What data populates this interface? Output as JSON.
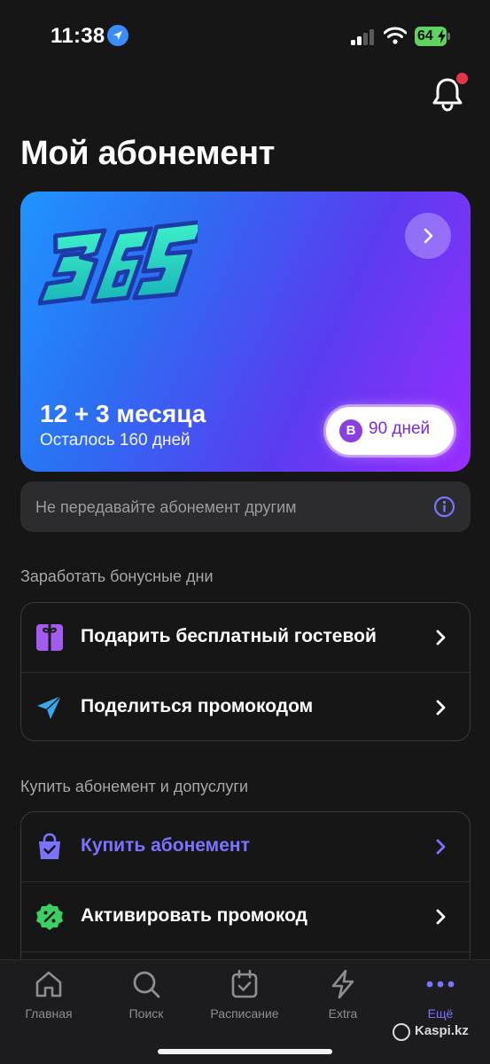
{
  "status_bar": {
    "time": "11:38",
    "battery": "64"
  },
  "page": {
    "title": "Мой абонемент"
  },
  "subscription": {
    "plan": "12 + 3 месяца",
    "remaining": "Осталось 160 дней",
    "badge_letter": "B",
    "badge_text": "90 дней"
  },
  "notice": {
    "text": "Не передавайте абонемент другим"
  },
  "bonus_section": {
    "title": "Заработать бонусные дни",
    "items": [
      {
        "label": "Подарить бесплатный гостевой",
        "icon": "gift-icon"
      },
      {
        "label": "Поделиться промокодом",
        "icon": "send-icon"
      }
    ]
  },
  "buy_section": {
    "title": "Купить абонемент и допуслуги",
    "items": [
      {
        "label": "Купить абонемент",
        "icon": "shopping-bag-icon"
      },
      {
        "label": "Активировать промокод",
        "icon": "discount-badge-icon"
      }
    ]
  },
  "tab_bar": {
    "tabs": [
      {
        "label": "Главная",
        "icon": "home-icon"
      },
      {
        "label": "Поиск",
        "icon": "search-icon"
      },
      {
        "label": "Расписание",
        "icon": "calendar-icon"
      },
      {
        "label": "Extra",
        "icon": "lightning-icon"
      },
      {
        "label": "Ещё",
        "icon": "more-icon",
        "active": true
      }
    ]
  },
  "watermark": {
    "text": "Kaspi.kz"
  },
  "colors": {
    "background": "#161617",
    "accent": "#7b72ff",
    "badge_text": "#7a2bd6",
    "notification_dot": "#e4344b"
  }
}
